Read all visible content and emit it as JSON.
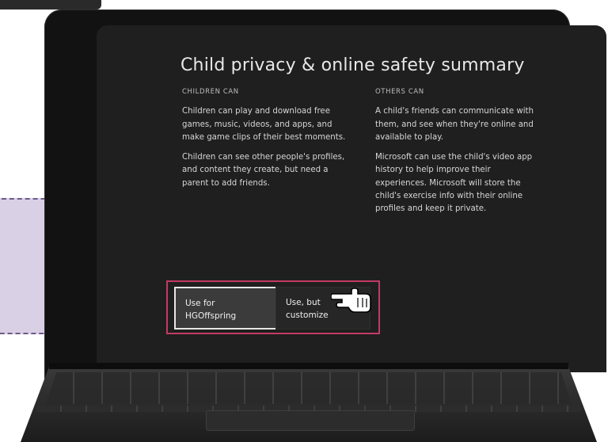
{
  "screen": {
    "title": "Child privacy & online safety summary",
    "children_can": {
      "heading": "CHILDREN CAN",
      "paragraphs": [
        "Children can play and download free games, music, videos, and apps, and make game clips of their best moments.",
        "Children can see other people's profiles, and content they create, but need a parent to add friends."
      ]
    },
    "others_can": {
      "heading": "OTHERS CAN",
      "paragraphs": [
        "A child's friends can communicate with them, and see when they're online and available to play.",
        "Microsoft can use the child's video app history to help improve their experiences. Microsoft will store the child's exercise info with their online profiles and keep it private."
      ]
    },
    "buttons": {
      "primary_label": "Use for HGOffspring",
      "secondary_label": "Use, but customize"
    }
  },
  "colors": {
    "highlight_frame": "#c23a64",
    "screen_bg": "#1f1f1f",
    "callout_bg": "#d9d0e6"
  },
  "icons": {
    "pointer": "pointing-hand-icon"
  }
}
